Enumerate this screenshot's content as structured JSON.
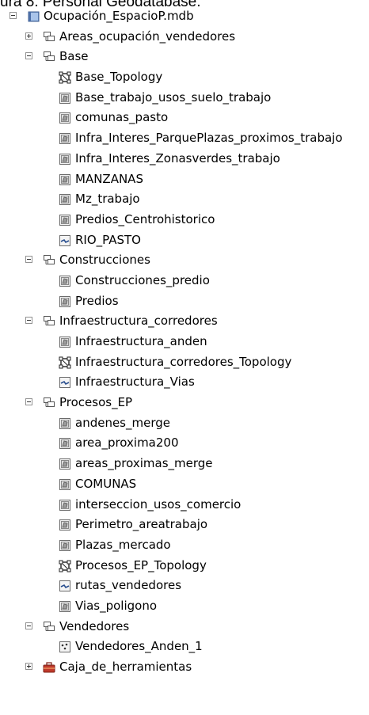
{
  "caption": "ura 8. Personal Geodatabase.",
  "tree": [
    {
      "level": 0,
      "expander": "minus",
      "icon": "geodatabase-icon",
      "label": "Ocupación_EspacioP.mdb"
    },
    {
      "level": 1,
      "expander": "plus",
      "icon": "feature-dataset-icon",
      "label": "Areas_ocupación_vendedores"
    },
    {
      "level": 1,
      "expander": "minus",
      "icon": "feature-dataset-icon",
      "label": "Base"
    },
    {
      "level": 2,
      "expander": "none",
      "icon": "topology-icon",
      "label": "Base_Topology"
    },
    {
      "level": 2,
      "expander": "none",
      "icon": "polygon-feature-class-icon",
      "label": "Base_trabajo_usos_suelo_trabajo"
    },
    {
      "level": 2,
      "expander": "none",
      "icon": "polygon-feature-class-icon",
      "label": "comunas_pasto"
    },
    {
      "level": 2,
      "expander": "none",
      "icon": "polygon-feature-class-icon",
      "label": "Infra_Interes_ParquePlazas_proximos_trabajo"
    },
    {
      "level": 2,
      "expander": "none",
      "icon": "polygon-feature-class-icon",
      "label": "Infra_Interes_Zonasverdes_trabajo"
    },
    {
      "level": 2,
      "expander": "none",
      "icon": "polygon-feature-class-icon",
      "label": "MANZANAS"
    },
    {
      "level": 2,
      "expander": "none",
      "icon": "polygon-feature-class-icon",
      "label": "Mz_trabajo"
    },
    {
      "level": 2,
      "expander": "none",
      "icon": "polygon-feature-class-icon",
      "label": "Predios_Centrohistorico"
    },
    {
      "level": 2,
      "expander": "none",
      "icon": "line-feature-class-icon",
      "label": "RIO_PASTO"
    },
    {
      "level": 1,
      "expander": "minus",
      "icon": "feature-dataset-icon",
      "label": "Construcciones"
    },
    {
      "level": 2,
      "expander": "none",
      "icon": "polygon-feature-class-icon",
      "label": "Construcciones_predio"
    },
    {
      "level": 2,
      "expander": "none",
      "icon": "polygon-feature-class-icon",
      "label": "Predios"
    },
    {
      "level": 1,
      "expander": "minus",
      "icon": "feature-dataset-icon",
      "label": "Infraestructura_corredores"
    },
    {
      "level": 2,
      "expander": "none",
      "icon": "polygon-feature-class-icon",
      "label": "Infraestructura_anden"
    },
    {
      "level": 2,
      "expander": "none",
      "icon": "topology-icon",
      "label": "Infraestructura_corredores_Topology"
    },
    {
      "level": 2,
      "expander": "none",
      "icon": "line-feature-class-icon",
      "label": "Infraestructura_Vias"
    },
    {
      "level": 1,
      "expander": "minus",
      "icon": "feature-dataset-icon",
      "label": "Procesos_EP"
    },
    {
      "level": 2,
      "expander": "none",
      "icon": "polygon-feature-class-icon",
      "label": "andenes_merge"
    },
    {
      "level": 2,
      "expander": "none",
      "icon": "polygon-feature-class-icon",
      "label": "area_proxima200"
    },
    {
      "level": 2,
      "expander": "none",
      "icon": "polygon-feature-class-icon",
      "label": "areas_proximas_merge"
    },
    {
      "level": 2,
      "expander": "none",
      "icon": "polygon-feature-class-icon",
      "label": "COMUNAS"
    },
    {
      "level": 2,
      "expander": "none",
      "icon": "polygon-feature-class-icon",
      "label": "interseccion_usos_comercio"
    },
    {
      "level": 2,
      "expander": "none",
      "icon": "polygon-feature-class-icon",
      "label": "Perimetro_areatrabajo"
    },
    {
      "level": 2,
      "expander": "none",
      "icon": "polygon-feature-class-icon",
      "label": "Plazas_mercado"
    },
    {
      "level": 2,
      "expander": "none",
      "icon": "topology-icon",
      "label": "Procesos_EP_Topology"
    },
    {
      "level": 2,
      "expander": "none",
      "icon": "line-feature-class-icon",
      "label": "rutas_vendedores"
    },
    {
      "level": 2,
      "expander": "none",
      "icon": "polygon-feature-class-icon",
      "label": "Vias_poligono"
    },
    {
      "level": 1,
      "expander": "minus",
      "icon": "feature-dataset-icon",
      "label": "Vendedores"
    },
    {
      "level": 2,
      "expander": "none",
      "icon": "point-feature-class-icon",
      "label": "Vendedores_Anden_1"
    },
    {
      "level": 1,
      "expander": "plus",
      "icon": "toolbox-icon",
      "label": "Caja_de_herramientas"
    }
  ]
}
